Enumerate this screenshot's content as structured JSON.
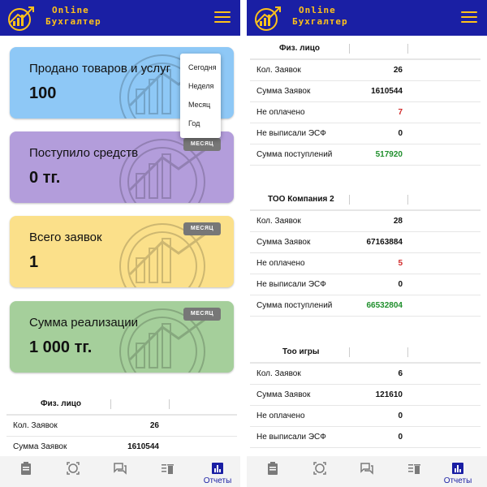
{
  "app": {
    "logo_line1": "Online",
    "logo_line2": "Бухгалтер",
    "brand_color": "#1a1fa4",
    "accent_color": "#ffc21a"
  },
  "left": {
    "cards": [
      {
        "title": "Продано товаров и услуг",
        "value": "100",
        "color": "#8ec8f6"
      },
      {
        "title": "Поступило средств",
        "value": "0 тг.",
        "color": "#b39ddb",
        "period": "МЕСЯЦ"
      },
      {
        "title": "Всего заявок",
        "value": "1",
        "color": "#fbe08a",
        "period": "МЕСЯЦ"
      },
      {
        "title": "Сумма реализации",
        "value": "1 000 тг.",
        "color": "#a5cf9b",
        "period": "МЕСЯЦ"
      }
    ],
    "dropdown": [
      "Сегодня",
      "Неделя",
      "Месяц",
      "Год"
    ],
    "table": {
      "name": "Физ. лицо",
      "rows": [
        {
          "label": "Кол. Заявок",
          "value": "26"
        },
        {
          "label": "Сумма Заявок",
          "value": "1610544"
        }
      ]
    }
  },
  "right": {
    "groups": [
      {
        "name": "Физ. лицо",
        "rows": [
          {
            "label": "Кол. Заявок",
            "value": "26",
            "tone": "normal"
          },
          {
            "label": "Сумма Заявок",
            "value": "1610544",
            "tone": "normal"
          },
          {
            "label": "Не оплачено",
            "value": "7",
            "tone": "red"
          },
          {
            "label": "Не выписали ЭСФ",
            "value": "0",
            "tone": "normal"
          },
          {
            "label": "Сумма поступлений",
            "value": "517920",
            "tone": "green"
          }
        ]
      },
      {
        "name": "ТОО Компания 2",
        "rows": [
          {
            "label": "Кол. Заявок",
            "value": "28",
            "tone": "normal"
          },
          {
            "label": "Сумма Заявок",
            "value": "67163884",
            "tone": "normal"
          },
          {
            "label": "Не оплачено",
            "value": "5",
            "tone": "red"
          },
          {
            "label": "Не выписали ЭСФ",
            "value": "0",
            "tone": "normal"
          },
          {
            "label": "Сумма поступлений",
            "value": "66532804",
            "tone": "green"
          }
        ]
      },
      {
        "name": "Тоо игры",
        "rows": [
          {
            "label": "Кол. Заявок",
            "value": "6",
            "tone": "normal"
          },
          {
            "label": "Сумма Заявок",
            "value": "121610",
            "tone": "normal"
          },
          {
            "label": "Не оплачено",
            "value": "0",
            "tone": "normal"
          },
          {
            "label": "Не выписали ЭСФ",
            "value": "0",
            "tone": "normal"
          }
        ]
      }
    ]
  },
  "bottom_nav": {
    "items": [
      {
        "icon": "clipboard-icon",
        "label": ""
      },
      {
        "icon": "target-icon",
        "label": ""
      },
      {
        "icon": "chat-icon",
        "label": ""
      },
      {
        "icon": "delete-list-icon",
        "label": ""
      },
      {
        "icon": "bar-chart-icon",
        "label": "Отчеты",
        "active": true
      }
    ]
  }
}
